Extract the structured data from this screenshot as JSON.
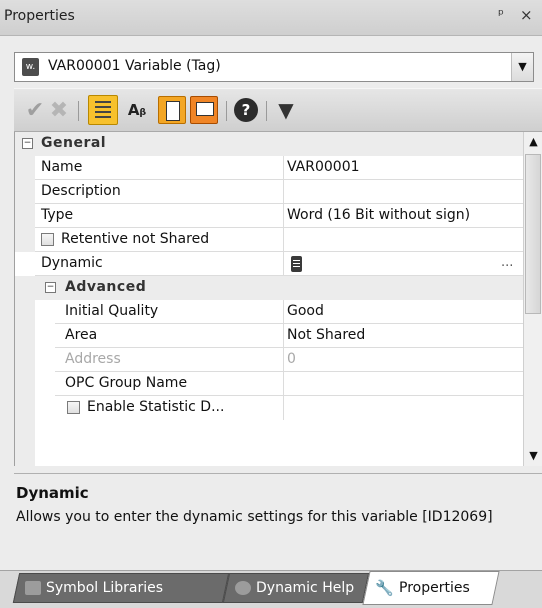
{
  "window": {
    "title": "Properties",
    "pin_glyph": "ᵖ",
    "close_glyph": "×"
  },
  "selector": {
    "icon_text": "w.",
    "text": "VAR00001 Variable (Tag)"
  },
  "toolbar": {
    "alpha_label": "Aᵦ",
    "help_label": "?"
  },
  "grid": {
    "general": {
      "label": "General"
    },
    "rows": [
      {
        "name": "Name",
        "value": "VAR00001"
      },
      {
        "name": "Description",
        "value": ""
      },
      {
        "name": "Type",
        "value": "Word (16 Bit without sign)"
      },
      {
        "name": "Retentive not Shared",
        "value": "",
        "checkbox": true
      },
      {
        "name": "Dynamic",
        "value": "",
        "dots": "..."
      }
    ],
    "advanced": {
      "label": "Advanced"
    },
    "adv_rows": [
      {
        "name": "Initial Quality",
        "value": "Good"
      },
      {
        "name": "Area",
        "value": "Not Shared"
      },
      {
        "name": "Address",
        "value": "0"
      },
      {
        "name": "OPC Group Name",
        "value": ""
      },
      {
        "name": "Enable Statistic D...",
        "value": "",
        "checkbox": true
      }
    ]
  },
  "description": {
    "title": "Dynamic",
    "text": "Allows you to enter the dynamic settings for this variable [ID12069]"
  },
  "tabs": [
    {
      "label": "Symbol Libraries",
      "active": false
    },
    {
      "label": "Dynamic Help",
      "active": false
    },
    {
      "label": "Properties",
      "active": true
    }
  ],
  "colors": {
    "disabled_text": "#a8a8a8",
    "toolbar_accent": "#f7c12d"
  }
}
